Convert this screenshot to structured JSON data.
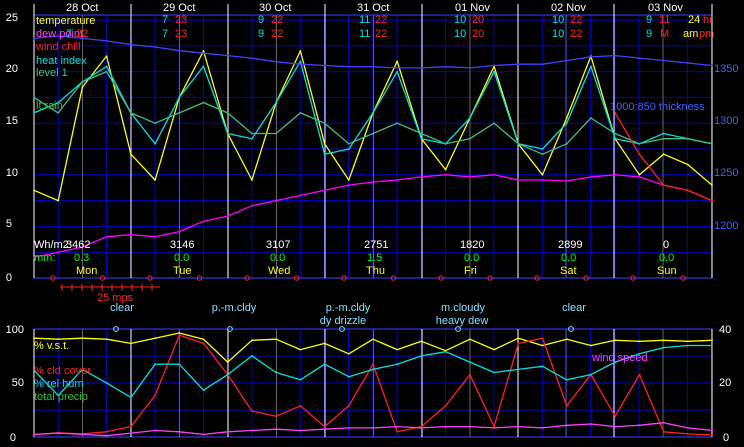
{
  "colors": {
    "grid": "#0000cc",
    "gridAlt": "#4040ff",
    "dayLine": "#ffffff",
    "temperature": "#ffff00",
    "dewPoint": "#ff00ff",
    "windChill": "#ff2020",
    "heatIndex": "#00e0e0",
    "level1": "#40c080",
    "ltRain": "#30c030",
    "thickness": "#4040ff",
    "whm2": "#ffffff",
    "rainMm": "#00ff00",
    "dayNames": "#ffff00",
    "axis": "#ffffff",
    "sky": "#80e0ff",
    "wind": "#ff40ff"
  },
  "header": {
    "dates": [
      "28 Oct",
      "29 Oct",
      "30 Oct",
      "31 Oct",
      "01 Nov",
      "02 Nov",
      "03 Nov"
    ],
    "hi_temp": [
      "",
      "7",
      "9",
      "11",
      "10",
      "10",
      "9"
    ],
    "lo_temp": [
      "",
      "23",
      "22",
      "22",
      "20",
      "22",
      "11"
    ],
    "hi_temp2": [
      "",
      "7",
      "9",
      "11",
      "10",
      "10",
      "9"
    ],
    "lo_temp2": [
      "",
      "23",
      "22",
      "22",
      "20",
      "22",
      "M"
    ],
    "hr24": "24",
    "hr24_unit": "hr",
    "ampm_am": "am",
    "ampm_pm": "pm"
  },
  "legend_top": {
    "temperature": "temperature",
    "dew_point": "dew point",
    "wind_chill": "wind chill",
    "heat_index": "heat index",
    "level1": "level 1",
    "lt_rain": "lt.rain",
    "thickness": "1000:850 thickness",
    "dew_overlay_a": "7",
    "dew_overlay_b": "22"
  },
  "summary": {
    "whm2_label": "Wh/m2:",
    "mm_label": "mm:",
    "whm2": [
      "3462",
      "3146",
      "3107",
      "2751",
      "1820",
      "2899",
      "0"
    ],
    "mm": [
      "0.3",
      "0.0",
      "0.0",
      "1.5",
      "0.0",
      "0.0",
      "0.0"
    ],
    "days": [
      "Mon",
      "Tue",
      "Wed",
      "Thu",
      "Fri",
      "Sat",
      "Sun"
    ]
  },
  "wind_scale": {
    "label": "25 mps"
  },
  "sky": {
    "labels_row1": [
      "clear",
      "p.-m.cldy",
      "p.-m.cldy",
      "m.cloudy",
      "clear"
    ],
    "labels_row2": [
      "",
      "",
      "dy drizzle",
      "heavy dew",
      ""
    ]
  },
  "legend_bottom": {
    "vst": "% v.s.t.",
    "cld_cover": "% cld cover",
    "rel_hum": "% rel hum",
    "total_precip": "total precip",
    "wind_speed": "wind speed"
  },
  "chart_data": [
    {
      "type": "line",
      "title": "",
      "xlabel": "",
      "ylabel": "",
      "x_days": [
        "28 Oct",
        "29 Oct",
        "30 Oct",
        "31 Oct",
        "01 Nov",
        "02 Nov",
        "03 Nov"
      ],
      "y_left_ticks": [
        "0",
        "5",
        "10",
        "15",
        "20",
        "25"
      ],
      "y_right_ticks": [
        "1200",
        "1250",
        "1300",
        "1350"
      ],
      "ylim": [
        0,
        25
      ],
      "y2lim": [
        1175,
        1385
      ],
      "x_hours": [
        0,
        6,
        12,
        18,
        24,
        30,
        36,
        42,
        48,
        54,
        60,
        66,
        72,
        78,
        84,
        90,
        96,
        102,
        108,
        114,
        120,
        126,
        132,
        138,
        144,
        150,
        156,
        162,
        168
      ],
      "series": [
        {
          "name": "temperature",
          "values": [
            8.5,
            7.5,
            18.5,
            21.5,
            12,
            9.5,
            17.5,
            22,
            14,
            9.5,
            17,
            22,
            13,
            9.5,
            16,
            21,
            13.5,
            10.5,
            15.5,
            20.5,
            13,
            10,
            15.5,
            21.5,
            13.5,
            10,
            12,
            11,
            9
          ]
        },
        {
          "name": "heat index",
          "values": [
            16,
            17,
            19,
            20.5,
            16,
            13,
            17.5,
            20.5,
            14,
            13.5,
            17,
            21,
            12,
            12.5,
            16,
            20,
            13.5,
            13,
            15.5,
            20,
            13,
            12.5,
            15,
            20.5,
            13.5,
            13,
            14,
            13.5,
            13
          ]
        },
        {
          "name": "level 1",
          "values": [
            17.5,
            16,
            19,
            20,
            16,
            15,
            16,
            17,
            16,
            14,
            14,
            16,
            15,
            13,
            14,
            15,
            14,
            13,
            13.5,
            15,
            13,
            12,
            13,
            15.5,
            14,
            13,
            13.5,
            13.5,
            13
          ]
        },
        {
          "name": "dew point",
          "values": [
            2,
            2.5,
            3,
            4,
            4.2,
            4,
            4.5,
            5.5,
            6,
            7,
            7.5,
            8,
            8.5,
            9,
            9.3,
            9.5,
            9.8,
            10,
            9.8,
            10,
            9.5,
            9.5,
            9.4,
            9.8,
            10,
            9.8,
            9,
            8.5,
            7.5
          ]
        },
        {
          "name": "wind chill",
          "values": [
            null,
            null,
            null,
            null,
            null,
            null,
            null,
            null,
            null,
            null,
            null,
            null,
            null,
            null,
            null,
            null,
            null,
            null,
            null,
            null,
            null,
            null,
            null,
            null,
            16,
            12,
            9,
            8.5,
            7.5
          ]
        },
        {
          "name": "1000:850 thickness",
          "values": [
            1370,
            1372,
            1370,
            1368,
            1365,
            1363,
            1360,
            1358,
            1356,
            1354,
            1351,
            1349,
            1348,
            1347,
            1347,
            1346,
            1346,
            1347,
            1346,
            1348,
            1349,
            1349,
            1352,
            1355,
            1356,
            1354,
            1352,
            1350,
            1348
          ]
        }
      ]
    },
    {
      "type": "line",
      "title": "",
      "xlabel": "",
      "ylabel": "",
      "y_left_ticks": [
        "0",
        "50",
        "100"
      ],
      "y_right_ticks": [
        "0",
        "20",
        "40"
      ],
      "ylim": [
        0,
        100
      ],
      "y2lim": [
        0,
        40
      ],
      "x_hours": [
        0,
        6,
        12,
        18,
        24,
        30,
        36,
        42,
        48,
        54,
        60,
        66,
        72,
        78,
        84,
        90,
        96,
        102,
        108,
        114,
        120,
        126,
        132,
        138,
        144,
        150,
        156,
        162,
        168
      ],
      "series": [
        {
          "name": "% v.s.t.",
          "values": [
            95,
            94,
            95,
            94,
            90,
            95,
            100,
            94,
            72,
            93,
            94,
            84,
            90,
            80,
            94,
            84,
            92,
            83,
            94,
            84,
            95,
            88,
            94,
            88,
            93,
            92,
            93,
            92,
            93
          ]
        },
        {
          "name": "% cld cover",
          "values": [
            2,
            4,
            3,
            5,
            10,
            40,
            98,
            90,
            60,
            25,
            20,
            30,
            10,
            30,
            70,
            5,
            10,
            30,
            60,
            10,
            90,
            95,
            30,
            60,
            20,
            60,
            5,
            3,
            2
          ]
        },
        {
          "name": "% rel hum",
          "values": [
            64,
            40,
            65,
            52,
            38,
            70,
            70,
            45,
            60,
            78,
            62,
            55,
            70,
            58,
            65,
            70,
            78,
            82,
            72,
            62,
            65,
            68,
            55,
            60,
            72,
            80,
            86,
            88,
            88
          ]
        },
        {
          "name": "wind speed",
          "values": [
            1.0,
            1.5,
            1.0,
            0.5,
            1.5,
            2.5,
            2.0,
            1.0,
            2.0,
            2.5,
            3.0,
            2.5,
            3.0,
            3.5,
            3.5,
            4.0,
            3.5,
            4.0,
            4.0,
            3.5,
            4.0,
            3.5,
            4.5,
            5.0,
            4.0,
            4.5,
            5.5,
            3.5,
            2.5
          ]
        }
      ]
    }
  ]
}
